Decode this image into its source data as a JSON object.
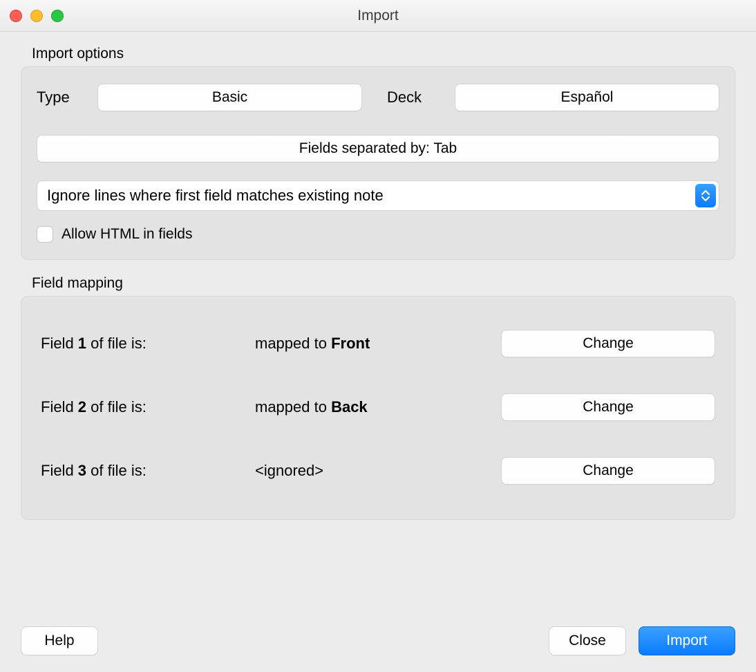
{
  "window": {
    "title": "Import"
  },
  "importOptions": {
    "groupLabel": "Import options",
    "typeLabel": "Type",
    "typeValue": "Basic",
    "deckLabel": "Deck",
    "deckValue": "Español",
    "fieldsSeparated": "Fields separated by: Tab",
    "behaviorSelect": "Ignore lines where first field matches existing note",
    "allowHtmlLabel": "Allow HTML in fields",
    "allowHtmlChecked": false
  },
  "fieldMapping": {
    "groupLabel": "Field mapping",
    "rows": [
      {
        "fieldNum": "1",
        "leftPrefix": "Field ",
        "leftSuffix": " of file is:",
        "midPrefix": "mapped to ",
        "midBold": "Front",
        "midFull": "",
        "change": "Change"
      },
      {
        "fieldNum": "2",
        "leftPrefix": "Field ",
        "leftSuffix": " of file is:",
        "midPrefix": "mapped to ",
        "midBold": "Back",
        "midFull": "",
        "change": "Change"
      },
      {
        "fieldNum": "3",
        "leftPrefix": "Field ",
        "leftSuffix": " of file is:",
        "midPrefix": "",
        "midBold": "",
        "midFull": "<ignored>",
        "change": "Change"
      }
    ]
  },
  "footer": {
    "help": "Help",
    "close": "Close",
    "import": "Import"
  }
}
